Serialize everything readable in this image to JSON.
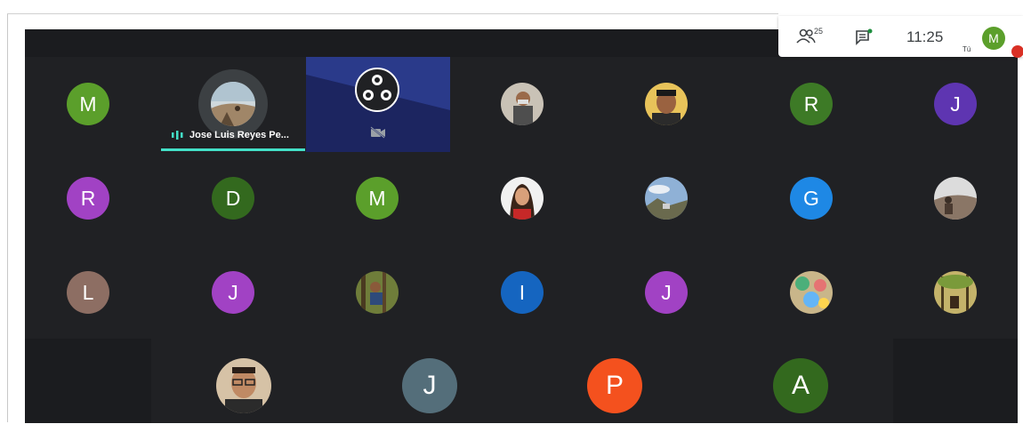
{
  "top_bar": {
    "participants_count": "25",
    "clock": "11:25",
    "self_initial": "M",
    "self_label": "Tú"
  },
  "speaking_tile": {
    "name": "Jose Luis Reyes Pe...",
    "accent_color": "#43e0c7"
  },
  "participants_row1": [
    {
      "initial": "M",
      "color": "#5b9f2b",
      "kind": "letter"
    },
    {
      "initial": "",
      "color": "#7a6a50",
      "kind": "photo",
      "icon": "photo-person-mask"
    },
    {
      "initial": "",
      "color": "#8a5a3a",
      "kind": "photo",
      "icon": "photo-man-smiling"
    },
    {
      "initial": "R",
      "color": "#3d7a26",
      "kind": "letter"
    },
    {
      "initial": "J",
      "color": "#5e35b1",
      "kind": "letter"
    }
  ],
  "participants_row2": [
    {
      "initial": "R",
      "color": "#a142c4",
      "kind": "letter"
    },
    {
      "initial": "D",
      "color": "#33691e",
      "kind": "letter"
    },
    {
      "initial": "M",
      "color": "#5b9f2b",
      "kind": "letter"
    },
    {
      "initial": "",
      "color": "#c44",
      "kind": "photo",
      "icon": "photo-woman"
    },
    {
      "initial": "",
      "color": "#7f9fb8",
      "kind": "photo",
      "icon": "photo-landscape"
    },
    {
      "initial": "G",
      "color": "#1e88e5",
      "kind": "letter"
    },
    {
      "initial": "",
      "color": "#9a8a7a",
      "kind": "photo",
      "icon": "photo-mountain"
    }
  ],
  "participants_row3": [
    {
      "initial": "L",
      "color": "#8d6e63",
      "kind": "letter"
    },
    {
      "initial": "J",
      "color": "#a142c4",
      "kind": "letter"
    },
    {
      "initial": "",
      "color": "#6d8a3a",
      "kind": "photo",
      "icon": "photo-forest"
    },
    {
      "initial": "I",
      "color": "#1565c0",
      "kind": "letter"
    },
    {
      "initial": "J",
      "color": "#a142c4",
      "kind": "letter"
    },
    {
      "initial": "",
      "color": "#b8a070",
      "kind": "photo",
      "icon": "photo-colorful"
    },
    {
      "initial": "",
      "color": "#7a8a40",
      "kind": "photo",
      "icon": "photo-trees"
    }
  ],
  "participants_row4": [
    {
      "initial": "",
      "color": "#c4a584",
      "kind": "photo",
      "icon": "photo-man-glasses"
    },
    {
      "initial": "J",
      "color": "#546e7a",
      "kind": "letter"
    },
    {
      "initial": "P",
      "color": "#f4511e",
      "kind": "letter"
    },
    {
      "initial": "A",
      "color": "#33691e",
      "kind": "letter"
    }
  ]
}
